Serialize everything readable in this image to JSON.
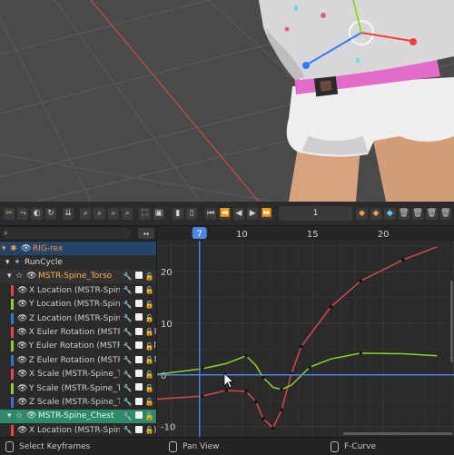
{
  "viewport": {
    "colors": {
      "background": "#4a4a4a",
      "grid": "#5e5e5e",
      "cursor_ring": "#ffffff",
      "axis_x": "#ff3b3b",
      "axis_y": "#2f7bff",
      "belt": "#e36cc9"
    }
  },
  "header": {
    "frame_value": "1",
    "icons": [
      "graph-editor-icon",
      "auto-normalize-icon",
      "pivot-icon",
      "snap-icon",
      "filter-icon",
      "zoom-icon",
      "zoom-icon",
      "zoom-icon",
      "frame-all-icon",
      "view-icon",
      "keyframe-icon",
      "keyframe-icon",
      "jump-start-icon",
      "prev-key-icon",
      "play-back-icon",
      "play-icon",
      "next-key-icon",
      "keyframe-add-icon",
      "keyframe-remove-icon",
      "keyframe-type-icon",
      "delete-icon",
      "delete-icon",
      "delete-icon",
      "delete-icon"
    ]
  },
  "channels": {
    "search_icon": "search-icon",
    "swap_icon": "swap-icon",
    "rows": [
      {
        "type": "obj",
        "label": "RIG-rex"
      },
      {
        "type": "act",
        "label": "RunCycle"
      },
      {
        "type": "grp",
        "label": "MSTR-Spine_Torso"
      },
      {
        "type": "ch",
        "label": "X Location (MSTR-Spine_Torso)",
        "color": "#e8414f"
      },
      {
        "type": "ch",
        "label": "Y Location (MSTR-Spine_Torso)",
        "color": "#8fcf2a"
      },
      {
        "type": "ch",
        "label": "Z Location (MSTR-Spine_Torso)",
        "color": "#3a73d8"
      },
      {
        "type": "ch",
        "label": "X Euler Rotation (MSTR-Spine_Torso)",
        "color": "#e8414f"
      },
      {
        "type": "ch",
        "label": "Y Euler Rotation (MSTR-Spine_Torso)",
        "color": "#8fcf2a"
      },
      {
        "type": "ch",
        "label": "Z Euler Rotation (MSTR-Spine_Torso)",
        "color": "#3a73d8"
      },
      {
        "type": "ch",
        "label": "X Scale (MSTR-Spine_Torso)",
        "color": "#e8414f"
      },
      {
        "type": "ch",
        "label": "Y Scale (MSTR-Spine_Torso)",
        "color": "#8fcf2a"
      },
      {
        "type": "ch",
        "label": "Z Scale (MSTR-Spine_Torso)",
        "color": "#3a73d8"
      },
      {
        "type": "grp",
        "label": "MSTR-Spine_Chest",
        "selected": true
      },
      {
        "type": "ch",
        "label": "X Location (MSTR-Spine_Chest)",
        "color": "#e8414f"
      }
    ]
  },
  "chart_data": {
    "type": "line",
    "x_ticks": [
      10,
      15,
      20
    ],
    "y_ticks": [
      20,
      10,
      0,
      -10
    ],
    "current_frame": "7",
    "xlim": [
      4,
      25
    ],
    "ylim": [
      -12,
      26
    ],
    "series": [
      {
        "color": "#d94553",
        "x": [
          4,
          7.2,
          8.9,
          10.3,
          11.0,
          11.5,
          12.2,
          12.8,
          13.5,
          14.2,
          16.3,
          18.4,
          21.4,
          23.8
        ],
        "y": [
          -4.7,
          -4.1,
          -3.0,
          -3.2,
          -5.2,
          -8.5,
          -10.3,
          -6.8,
          0.2,
          5.5,
          13.2,
          18.2,
          22.3,
          24.8
        ]
      },
      {
        "color": "#8ad32a",
        "x": [
          4,
          7.2,
          8.9,
          10.3,
          11.0,
          11.5,
          12.2,
          12.8,
          13.5,
          14.8,
          16.3,
          18.4,
          21.4,
          23.8
        ],
        "y": [
          0.1,
          1.2,
          2.2,
          3.7,
          1.8,
          -0.5,
          -2.4,
          -2.8,
          -2.0,
          1.5,
          3.1,
          4.2,
          4.1,
          3.7
        ]
      },
      {
        "color": "#4a86e8",
        "x": [
          4,
          25
        ],
        "y": [
          0,
          0
        ]
      }
    ]
  },
  "status": {
    "select": "Select Keyframes",
    "pan": "Pan View",
    "fcurve": "F-Curve"
  }
}
